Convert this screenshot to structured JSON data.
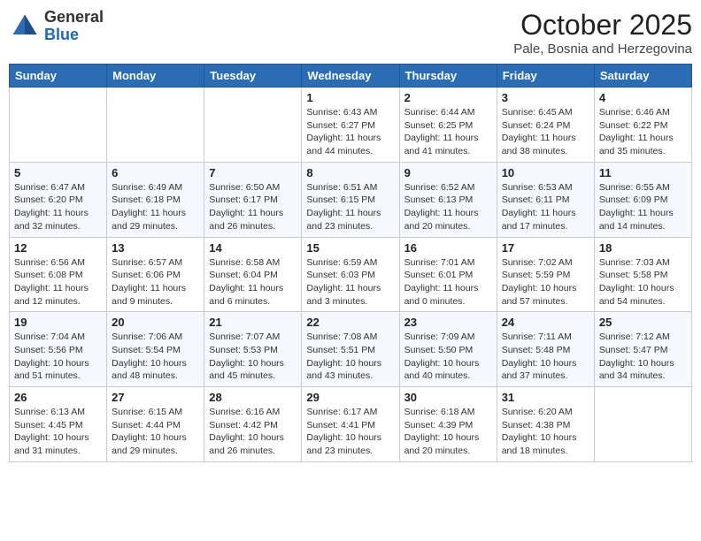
{
  "header": {
    "logo_general": "General",
    "logo_blue": "Blue",
    "month": "October 2025",
    "location": "Pale, Bosnia and Herzegovina"
  },
  "weekdays": [
    "Sunday",
    "Monday",
    "Tuesday",
    "Wednesday",
    "Thursday",
    "Friday",
    "Saturday"
  ],
  "weeks": [
    [
      {
        "day": "",
        "info": ""
      },
      {
        "day": "",
        "info": ""
      },
      {
        "day": "",
        "info": ""
      },
      {
        "day": "1",
        "info": "Sunrise: 6:43 AM\nSunset: 6:27 PM\nDaylight: 11 hours and 44 minutes."
      },
      {
        "day": "2",
        "info": "Sunrise: 6:44 AM\nSunset: 6:25 PM\nDaylight: 11 hours and 41 minutes."
      },
      {
        "day": "3",
        "info": "Sunrise: 6:45 AM\nSunset: 6:24 PM\nDaylight: 11 hours and 38 minutes."
      },
      {
        "day": "4",
        "info": "Sunrise: 6:46 AM\nSunset: 6:22 PM\nDaylight: 11 hours and 35 minutes."
      }
    ],
    [
      {
        "day": "5",
        "info": "Sunrise: 6:47 AM\nSunset: 6:20 PM\nDaylight: 11 hours and 32 minutes."
      },
      {
        "day": "6",
        "info": "Sunrise: 6:49 AM\nSunset: 6:18 PM\nDaylight: 11 hours and 29 minutes."
      },
      {
        "day": "7",
        "info": "Sunrise: 6:50 AM\nSunset: 6:17 PM\nDaylight: 11 hours and 26 minutes."
      },
      {
        "day": "8",
        "info": "Sunrise: 6:51 AM\nSunset: 6:15 PM\nDaylight: 11 hours and 23 minutes."
      },
      {
        "day": "9",
        "info": "Sunrise: 6:52 AM\nSunset: 6:13 PM\nDaylight: 11 hours and 20 minutes."
      },
      {
        "day": "10",
        "info": "Sunrise: 6:53 AM\nSunset: 6:11 PM\nDaylight: 11 hours and 17 minutes."
      },
      {
        "day": "11",
        "info": "Sunrise: 6:55 AM\nSunset: 6:09 PM\nDaylight: 11 hours and 14 minutes."
      }
    ],
    [
      {
        "day": "12",
        "info": "Sunrise: 6:56 AM\nSunset: 6:08 PM\nDaylight: 11 hours and 12 minutes."
      },
      {
        "day": "13",
        "info": "Sunrise: 6:57 AM\nSunset: 6:06 PM\nDaylight: 11 hours and 9 minutes."
      },
      {
        "day": "14",
        "info": "Sunrise: 6:58 AM\nSunset: 6:04 PM\nDaylight: 11 hours and 6 minutes."
      },
      {
        "day": "15",
        "info": "Sunrise: 6:59 AM\nSunset: 6:03 PM\nDaylight: 11 hours and 3 minutes."
      },
      {
        "day": "16",
        "info": "Sunrise: 7:01 AM\nSunset: 6:01 PM\nDaylight: 11 hours and 0 minutes."
      },
      {
        "day": "17",
        "info": "Sunrise: 7:02 AM\nSunset: 5:59 PM\nDaylight: 10 hours and 57 minutes."
      },
      {
        "day": "18",
        "info": "Sunrise: 7:03 AM\nSunset: 5:58 PM\nDaylight: 10 hours and 54 minutes."
      }
    ],
    [
      {
        "day": "19",
        "info": "Sunrise: 7:04 AM\nSunset: 5:56 PM\nDaylight: 10 hours and 51 minutes."
      },
      {
        "day": "20",
        "info": "Sunrise: 7:06 AM\nSunset: 5:54 PM\nDaylight: 10 hours and 48 minutes."
      },
      {
        "day": "21",
        "info": "Sunrise: 7:07 AM\nSunset: 5:53 PM\nDaylight: 10 hours and 45 minutes."
      },
      {
        "day": "22",
        "info": "Sunrise: 7:08 AM\nSunset: 5:51 PM\nDaylight: 10 hours and 43 minutes."
      },
      {
        "day": "23",
        "info": "Sunrise: 7:09 AM\nSunset: 5:50 PM\nDaylight: 10 hours and 40 minutes."
      },
      {
        "day": "24",
        "info": "Sunrise: 7:11 AM\nSunset: 5:48 PM\nDaylight: 10 hours and 37 minutes."
      },
      {
        "day": "25",
        "info": "Sunrise: 7:12 AM\nSunset: 5:47 PM\nDaylight: 10 hours and 34 minutes."
      }
    ],
    [
      {
        "day": "26",
        "info": "Sunrise: 6:13 AM\nSunset: 4:45 PM\nDaylight: 10 hours and 31 minutes."
      },
      {
        "day": "27",
        "info": "Sunrise: 6:15 AM\nSunset: 4:44 PM\nDaylight: 10 hours and 29 minutes."
      },
      {
        "day": "28",
        "info": "Sunrise: 6:16 AM\nSunset: 4:42 PM\nDaylight: 10 hours and 26 minutes."
      },
      {
        "day": "29",
        "info": "Sunrise: 6:17 AM\nSunset: 4:41 PM\nDaylight: 10 hours and 23 minutes."
      },
      {
        "day": "30",
        "info": "Sunrise: 6:18 AM\nSunset: 4:39 PM\nDaylight: 10 hours and 20 minutes."
      },
      {
        "day": "31",
        "info": "Sunrise: 6:20 AM\nSunset: 4:38 PM\nDaylight: 10 hours and 18 minutes."
      },
      {
        "day": "",
        "info": ""
      }
    ]
  ]
}
